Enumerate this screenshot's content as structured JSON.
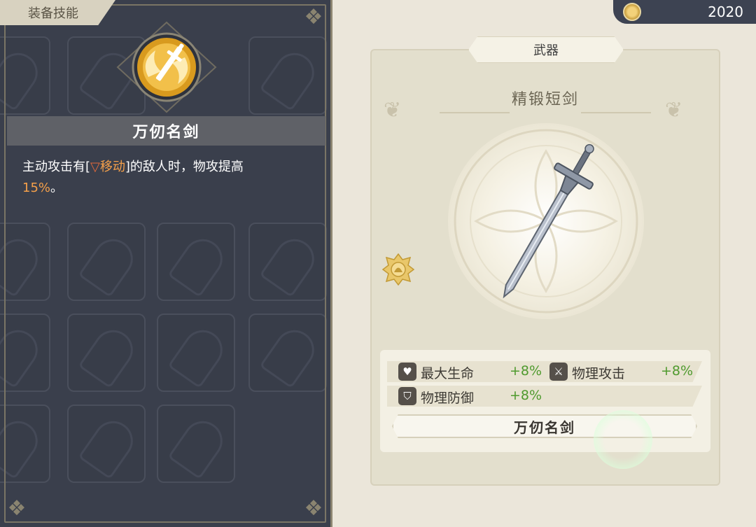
{
  "left_panel": {
    "tab_label": "装备技能",
    "skill_name": "万仞名剑",
    "description": {
      "prefix": "主动攻击有[",
      "tag_icon": "▽",
      "tag_text": "移动",
      "middle": "]的敌人时，物攻提高",
      "value": "15%",
      "suffix": "。"
    },
    "skill_icon": "sword-swirl-icon"
  },
  "currency": {
    "icon": "coin-icon",
    "amount": "2020"
  },
  "item_card": {
    "category_tab": "武器",
    "item_name": "精锻短剑",
    "item_image": "sword-icon",
    "rank_badge": "rank-badge-icon",
    "stats": [
      {
        "icon": "heart-icon",
        "label": "最大生命",
        "value": "+8%"
      },
      {
        "icon": "sword-icon",
        "label": "物理攻击",
        "value": "+8%"
      },
      {
        "icon": "shield-icon",
        "label": "物理防御",
        "value": "+8%"
      }
    ],
    "skill_button_label": "万仞名剑"
  },
  "colors": {
    "panel_dark": "#3a3f4c",
    "highlight_orange": "#f5a04a",
    "stat_green": "#4f9a2e",
    "card_bg": "#e3dfcd"
  }
}
